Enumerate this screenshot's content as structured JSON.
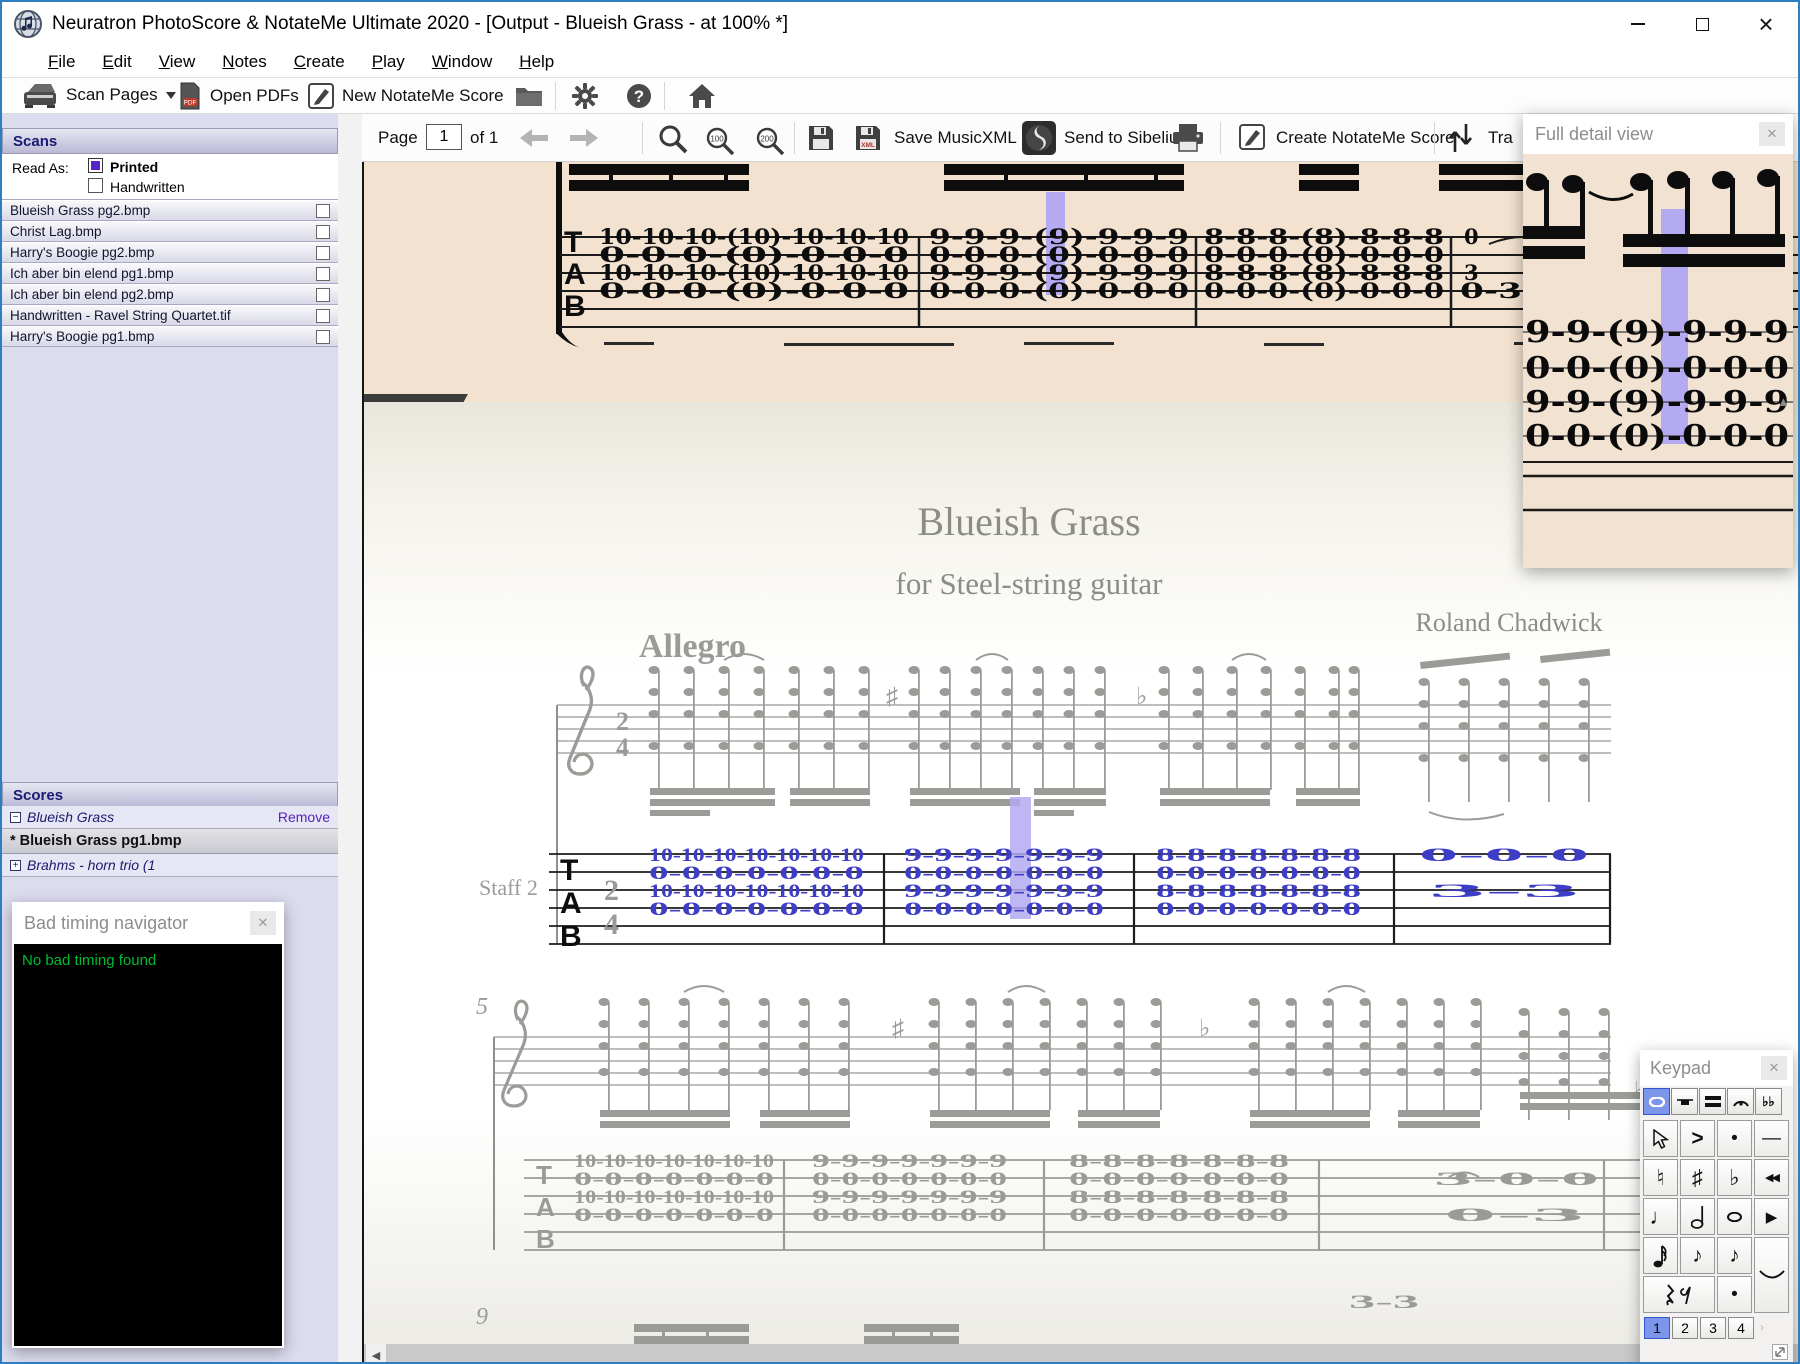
{
  "window": {
    "title": "Neuratron PhotoScore & NotateMe Ultimate 2020 - [Output - Blueish Grass - at 100% *]"
  },
  "menu": {
    "items": [
      "File",
      "Edit",
      "View",
      "Notes",
      "Create",
      "Play",
      "Window",
      "Help"
    ]
  },
  "app_toolbar": {
    "scan_pages": "Scan Pages",
    "open_pdfs": "Open PDFs",
    "new_notateme_score": "New NotateMe Score"
  },
  "doc_toolbar": {
    "page_label": "Page",
    "page_value": "1",
    "page_of": "of 1",
    "save_musicxml": "Save MusicXML",
    "send_to_sibelius": "Send to Sibelius",
    "create_notateme_score": "Create NotateMe Score",
    "transpose_label": "Tra"
  },
  "scans_panel": {
    "title": "Scans",
    "read_as_label": "Read As:",
    "printed_label": "Printed",
    "handwritten_label": "Handwritten",
    "files": [
      "Blueish Grass pg2.bmp",
      "Christ Lag.bmp",
      "Harry's Boogie pg2.bmp",
      "Ich aber bin elend pg1.bmp",
      "Ich aber bin elend pg2.bmp",
      "Handwritten - Ravel String Quartet.tif",
      "Harry's Boogie pg1.bmp"
    ]
  },
  "scores_panel": {
    "title": "Scores",
    "score_name": "Blueish Grass",
    "remove_label": "Remove",
    "selected_page": "* Blueish Grass pg1.bmp",
    "other_score": "Brahms - horn trio (1"
  },
  "bad_timing_panel": {
    "title": "Bad timing navigator",
    "message": "No bad timing found"
  },
  "full_detail_panel": {
    "title": "Full detail view",
    "tab_rows": [
      "9-9-(9)-9-9-9",
      "0-0-(0)-0-0-0",
      "9-9-(9)-9-9-9",
      "0-0-(0)-0-0-0"
    ]
  },
  "keypad_panel": {
    "title": "Keypad",
    "keys": {
      "accent": ">",
      "dot": "•",
      "dash": "—",
      "natural": "♮",
      "sharp": "♯",
      "flat": "♭",
      "rewind": "◀◀",
      "quarter_note": "♩",
      "play": "▶",
      "eighth_note": "♪",
      "eighth_note2": "♪",
      "augment_dot": "•",
      "double_flat": "♭♭"
    },
    "pages": [
      "1",
      "2",
      "3",
      "4"
    ]
  },
  "score": {
    "title": "Blueish Grass",
    "subtitle": "for Steel-string guitar",
    "composer": "Roland Chadwick",
    "tempo": "Allegro",
    "staff_label": "Staff 2",
    "time_top": "2",
    "time_bottom": "4",
    "tab_letters": [
      "T",
      "A",
      "B"
    ],
    "bar_number_5": "5",
    "bar_number_9": "9",
    "system1": {
      "measures": [
        {
          "rows": [
            "10-10-10-10-10-10-10",
            "0-0-0-0-0-0-0",
            "10-10-10-10-10-10-10",
            "0-0-0-0-0-0-0"
          ]
        },
        {
          "rows": [
            "9-9-9-9-9-9-9",
            "0-0-0-0-0-0-0",
            "9-9-9-9-9-9-9",
            "0-0-0-0-0-0-0"
          ]
        },
        {
          "rows": [
            "8-8-8-8-8-8-8",
            "0-0-0-0-0-0-0",
            "8-8-8-8-8-8-8",
            "0-0-0-0-0-0-0"
          ]
        },
        {
          "rows": [
            "0-0-0",
            "3-3"
          ]
        }
      ]
    },
    "system2": {
      "measures": [
        {
          "rows": [
            "10-10-10-10-10-10-10",
            "0-0-0-0-0-0-0",
            "10-10-10-10-10-10-10",
            "0-0-0-0-0-0-0"
          ]
        },
        {
          "rows": [
            "9-9-9-9-9-9-9",
            "0-0-0-0-0-0-0",
            "9-9-9-9-9-9-9",
            "0-0-0-0-0-0-0"
          ]
        },
        {
          "rows": [
            "8-8-8-8-8-8-8",
            "0-0-0-0-0-0-0",
            "8-8-8-8-8-8-8",
            "0-0-0-0-0-0-0"
          ]
        },
        {
          "rows": [
            "3-0-0",
            "0-3"
          ]
        }
      ],
      "extra_numbers": "3-3"
    }
  },
  "scan_view": {
    "tab_letters": [
      "T",
      "A",
      "B"
    ],
    "measures": [
      {
        "rows": [
          "10-10-10-(10)-10-10-10",
          "0-0-0-(0)-0-0-0",
          "10-10-10-(10)-10-10-10",
          "0-0-0-(0)-0-0-0"
        ]
      },
      {
        "rows": [
          "9-9-9-(9)-9-9-9",
          "0-0-0-(0)-0-0-0",
          "9-9-9-(9)-9-9-9",
          "0-0-0-(0)-0-0-0"
        ]
      },
      {
        "rows": [
          "8-8-8-(8)-8-8-8",
          "0-0-0-(0)-0-0-0",
          "8-8-8-(8)-8-8-8",
          "0-0-0-(0)-0-0-0"
        ]
      },
      {
        "rows": [
          "0",
          "3",
          "0-3"
        ]
      }
    ]
  }
}
